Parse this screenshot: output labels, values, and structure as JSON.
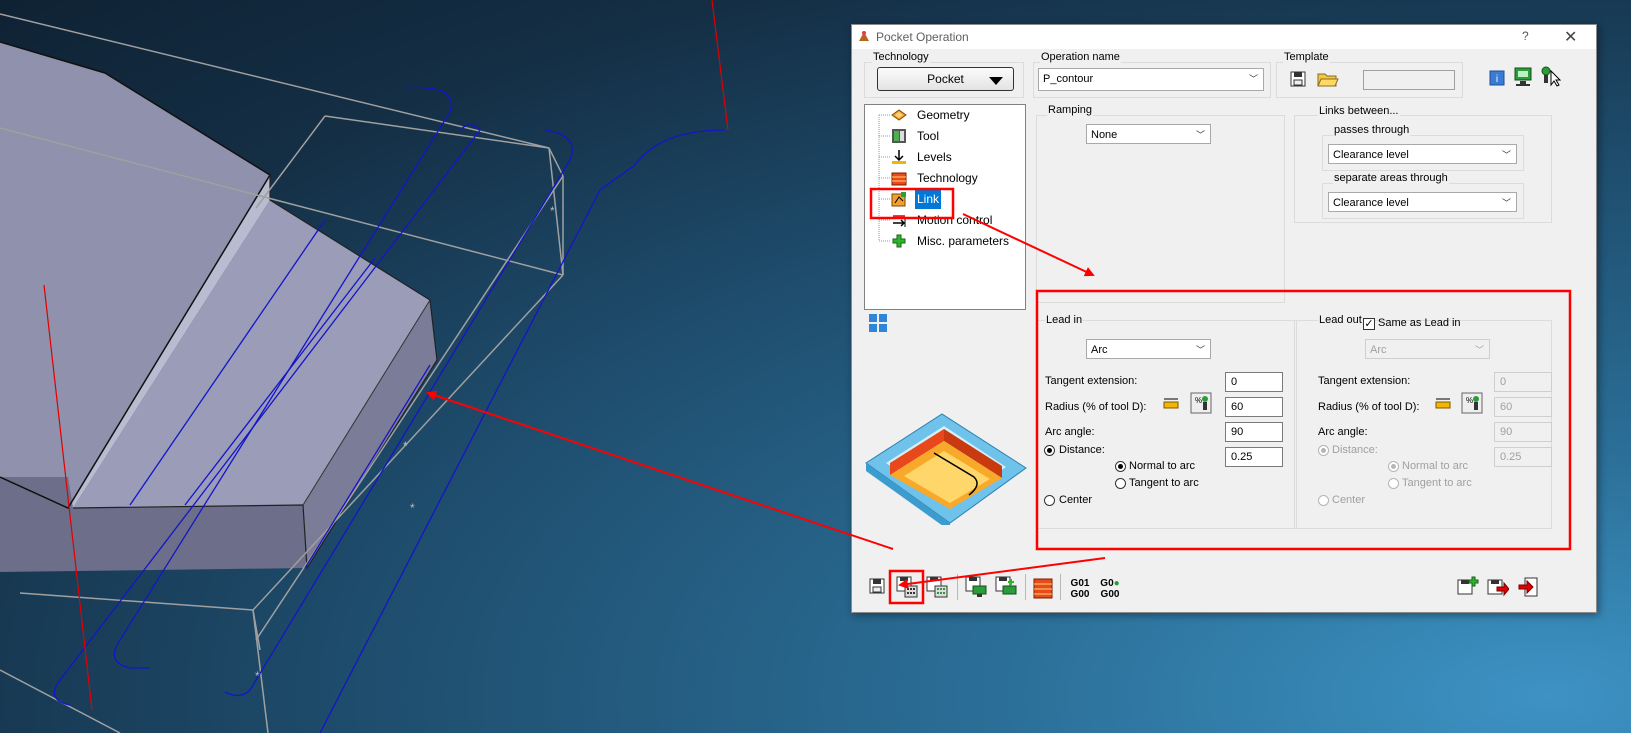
{
  "dialog": {
    "title": "Pocket Operation",
    "help_label": "?",
    "close_label": "✕"
  },
  "technology": {
    "group_label": "Technology",
    "value": "Pocket"
  },
  "operation": {
    "group_label": "Operation name",
    "value": "P_contour"
  },
  "template": {
    "group_label": "Template",
    "value": ""
  },
  "tree": {
    "items": [
      {
        "label": "Geometry",
        "icon": "geometry-icon"
      },
      {
        "label": "Tool",
        "icon": "tool-icon"
      },
      {
        "label": "Levels",
        "icon": "levels-icon"
      },
      {
        "label": "Technology",
        "icon": "technology-icon"
      },
      {
        "label": "Link",
        "icon": "link-icon"
      },
      {
        "label": "Motion control",
        "icon": "motion-control-icon"
      },
      {
        "label": "Misc. parameters",
        "icon": "misc-parameters-icon"
      }
    ],
    "selected": "Link"
  },
  "ramping": {
    "group_label": "Ramping",
    "value": "None"
  },
  "links_between": {
    "group_label": "Links between...",
    "passes_label": "passes through",
    "passes_value": "Clearance level",
    "separate_label": "separate areas through",
    "separate_value": "Clearance level"
  },
  "lead_in": {
    "group_label": "Lead in",
    "type": "Arc",
    "tangent_label": "Tangent  extension:",
    "tangent_value": "0",
    "radius_label": "Radius (% of tool D):",
    "radius_value": "60",
    "arc_angle_label": "Arc angle:",
    "arc_angle_value": "90",
    "distance_label": "Distance:",
    "distance_value": "0.25",
    "normal_label": "Normal to arc",
    "tangent_arc_label": "Tangent to arc",
    "center_label": "Center"
  },
  "lead_out": {
    "group_label": "Lead out",
    "same_label": "Same as Lead in",
    "same_checked": true,
    "type": "Arc",
    "tangent_label": "Tangent  extension:",
    "tangent_value": "0",
    "radius_label": "Radius (% of tool D):",
    "radius_value": "60",
    "arc_angle_label": "Arc angle:",
    "arc_angle_value": "90",
    "distance_label": "Distance:",
    "distance_value": "0.25",
    "normal_label": "Normal to arc",
    "tangent_arc_label": "Tangent to arc",
    "center_label": "Center"
  },
  "toolbar": {
    "g01_line1": "G01",
    "g01_line2": "G00",
    "g0_line1": "G0",
    "g0_line2": "G00"
  },
  "colors": {
    "highlight": "#ff0000",
    "selection": "#0078d7",
    "toolpath": "#1515c8"
  }
}
